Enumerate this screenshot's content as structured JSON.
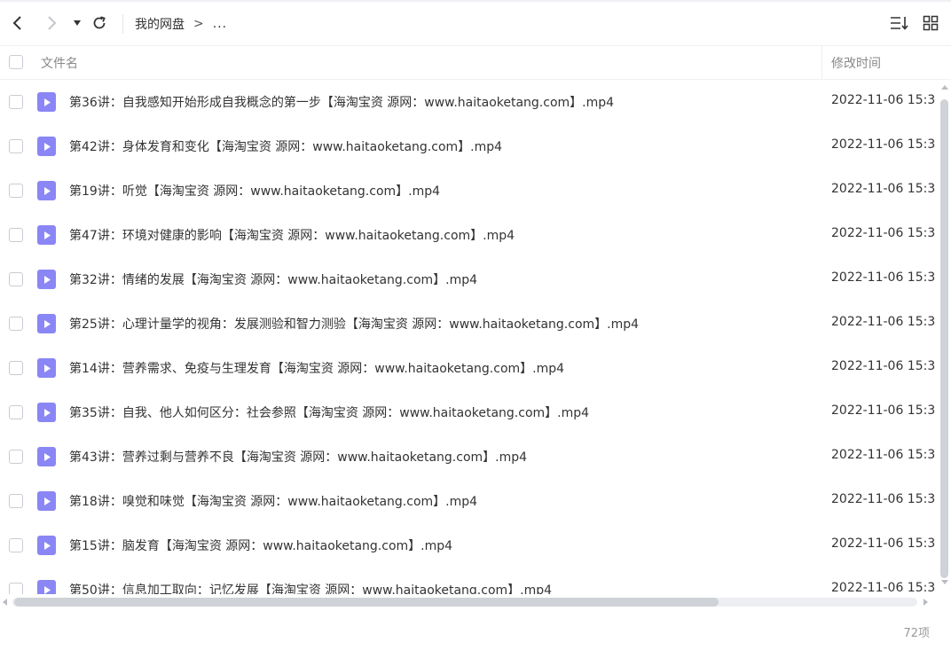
{
  "toolbar": {
    "back_icon": "chevron-left-icon",
    "forward_icon": "chevron-right-icon",
    "history_icon": "caret-down-icon",
    "refresh_icon": "refresh-icon",
    "sort_icon": "sort-list-icon",
    "grid_icon": "grid-view-icon"
  },
  "breadcrumb": {
    "root": "我的网盘",
    "separator": ">",
    "rest": "..."
  },
  "table": {
    "col_name": "文件名",
    "col_time": "修改时间"
  },
  "colors": {
    "video_icon": "#8a86f5",
    "text": "#333333",
    "muted": "#999999"
  },
  "files": [
    {
      "name": "第36讲：自我感知开始形成自我概念的第一步【海淘宝资 源网：www.haitaoketang.com】.mp4",
      "time": "2022-11-06 15:3"
    },
    {
      "name": "第42讲：身体发育和变化【海淘宝资 源网：www.haitaoketang.com】.mp4",
      "time": "2022-11-06 15:3"
    },
    {
      "name": "第19讲：听觉【海淘宝资 源网：www.haitaoketang.com】.mp4",
      "time": "2022-11-06 15:3"
    },
    {
      "name": "第47讲：环境对健康的影响【海淘宝资 源网：www.haitaoketang.com】.mp4",
      "time": "2022-11-06 15:3"
    },
    {
      "name": "第32讲：情绪的发展【海淘宝资 源网：www.haitaoketang.com】.mp4",
      "time": "2022-11-06 15:3"
    },
    {
      "name": "第25讲：心理计量学的视角：发展测验和智力测验【海淘宝资 源网：www.haitaoketang.com】.mp4",
      "time": "2022-11-06 15:3"
    },
    {
      "name": "第14讲：营养需求、免疫与生理发育【海淘宝资 源网：www.haitaoketang.com】.mp4",
      "time": "2022-11-06 15:3"
    },
    {
      "name": "第35讲：自我、他人如何区分：社会参照【海淘宝资 源网：www.haitaoketang.com】.mp4",
      "time": "2022-11-06 15:3"
    },
    {
      "name": "第43讲：营养过剩与营养不良【海淘宝资 源网：www.haitaoketang.com】.mp4",
      "time": "2022-11-06 15:3"
    },
    {
      "name": "第18讲：嗅觉和味觉【海淘宝资 源网：www.haitaoketang.com】.mp4",
      "time": "2022-11-06 15:3"
    },
    {
      "name": "第15讲：脑发育【海淘宝资 源网：www.haitaoketang.com】.mp4",
      "time": "2022-11-06 15:3"
    },
    {
      "name": "第50讲：信息加工取向：记忆发展【海淘宝资 源网：www.haitaoketang.com】.mp4",
      "time": "2022-11-06 15:3"
    }
  ],
  "footer": {
    "count": "72项"
  }
}
